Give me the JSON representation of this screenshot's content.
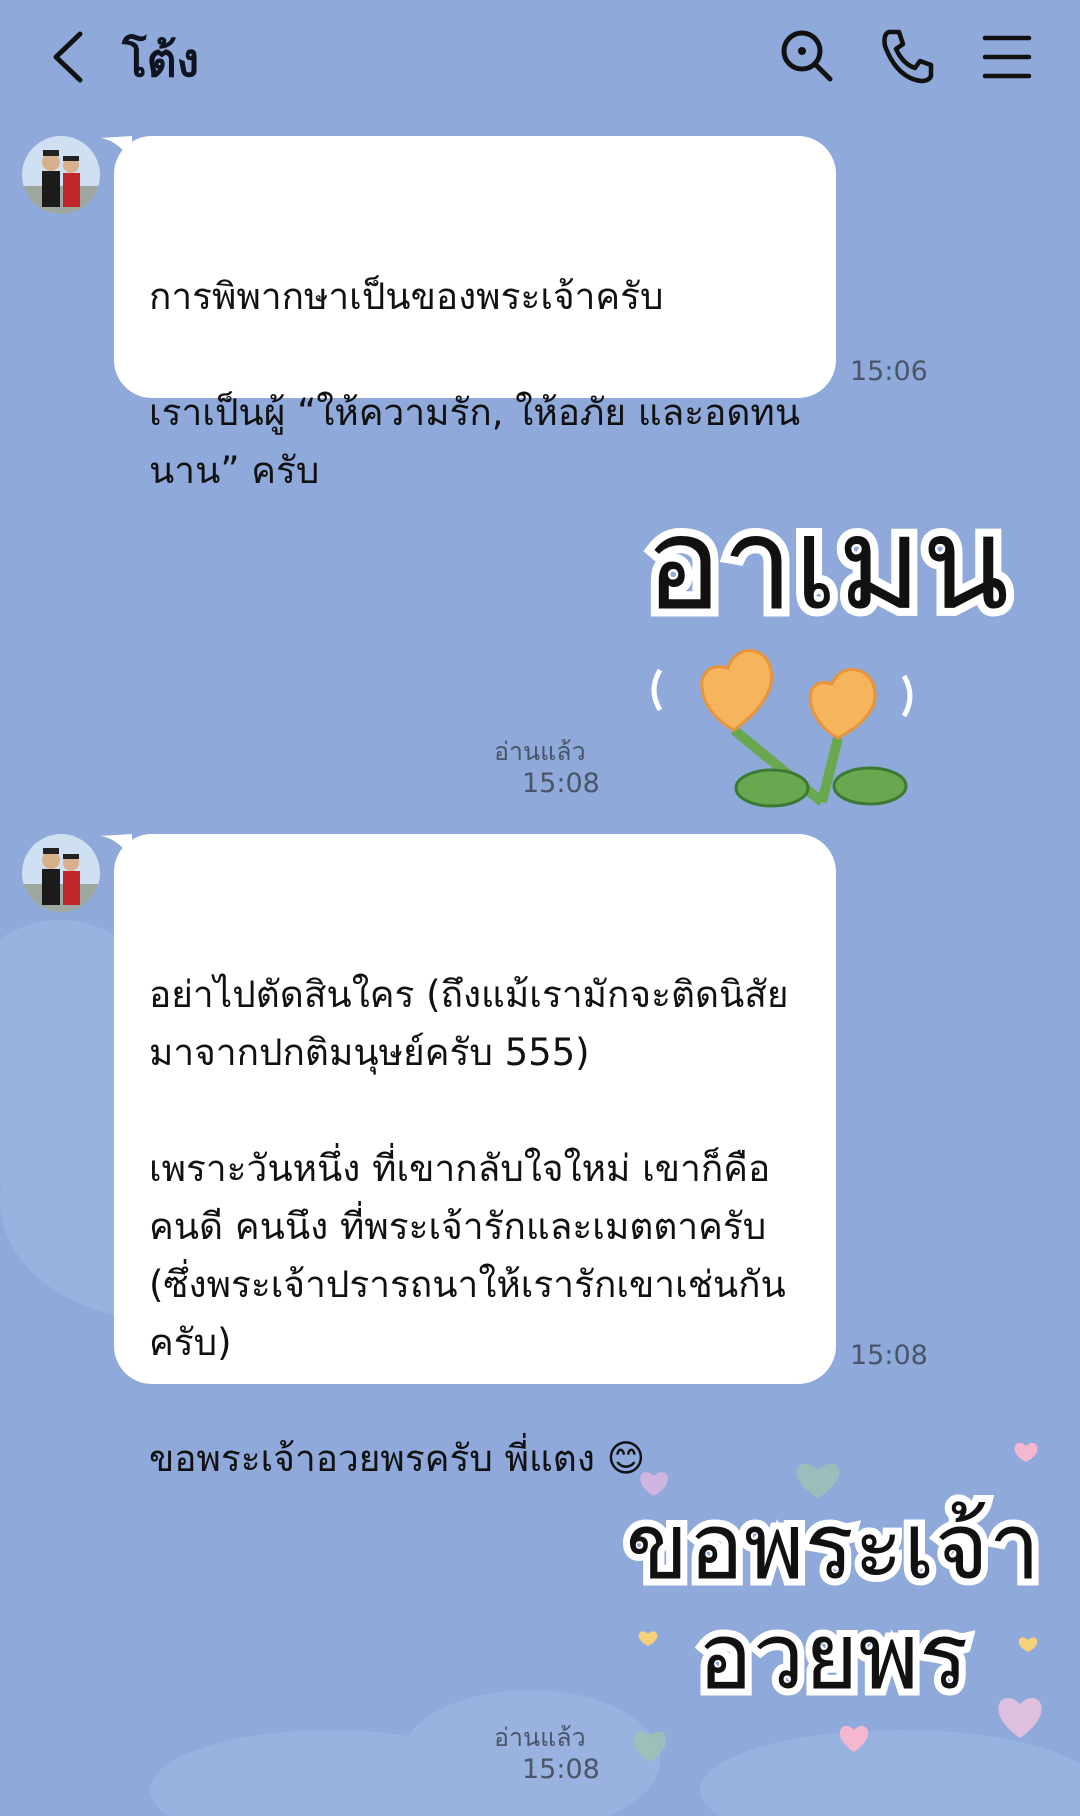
{
  "header": {
    "contact_name": "โต้ง",
    "icons": [
      "back-icon",
      "search-icon",
      "phone-icon",
      "menu-icon"
    ]
  },
  "messages": [
    {
      "text": "การพิพากษาเป็นของพระเจ้าครับ\n\nเราเป็นผู้ “ให้ความรัก, ให้อภัย และอดทนนาน” ครับ",
      "time": "15:06"
    },
    {
      "sticker_text": "อาเมน",
      "read": "อ่านแล้ว",
      "time": "15:08"
    },
    {
      "text": "อย่าไปตัดสินใคร (ถึงแม้เรามักจะติดนิสัยมาจากปกติมนุษย์ครับ 555)\n\nเพราะวันหนึ่ง ที่เขากลับใจใหม่ เขาก็คือ คนดี คนนึง ที่พระเจ้ารักและเมตตาครับ (ซึ่งพระเจ้าปรารถนาให้เรารักเขาเช่นกันครับ)\n\nขอพระเจ้าอวยพรครับ พี่แตง 😊",
      "time": "15:08"
    },
    {
      "sticker_text_line1": "ขอพระเจ้า",
      "sticker_text_line2": "อวยพร",
      "read": "อ่านแล้ว",
      "time": "15:08"
    }
  ],
  "colors": {
    "background": "#8fa9db",
    "bubble": "#ffffff",
    "flower": "#f6b45c",
    "leaf": "#6aa84f"
  }
}
